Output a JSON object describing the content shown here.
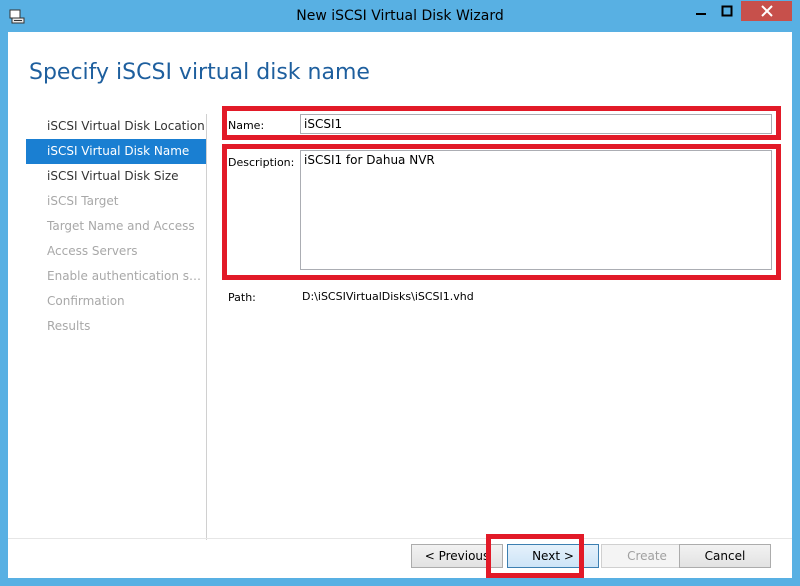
{
  "window": {
    "title": "New iSCSI Virtual Disk Wizard"
  },
  "page": {
    "heading": "Specify iSCSI virtual disk name"
  },
  "nav": {
    "items": [
      {
        "label": "iSCSI Virtual Disk Location",
        "state": "normal"
      },
      {
        "label": "iSCSI Virtual Disk Name",
        "state": "selected"
      },
      {
        "label": "iSCSI Virtual Disk Size",
        "state": "normal"
      },
      {
        "label": "iSCSI Target",
        "state": "disabled"
      },
      {
        "label": "Target Name and Access",
        "state": "disabled"
      },
      {
        "label": "Access Servers",
        "state": "disabled"
      },
      {
        "label": "Enable authentication ser...",
        "state": "disabled"
      },
      {
        "label": "Confirmation",
        "state": "disabled"
      },
      {
        "label": "Results",
        "state": "disabled"
      }
    ]
  },
  "form": {
    "name_label": "Name:",
    "name_value": "iSCSI1",
    "description_label": "Description:",
    "description_value": "iSCSI1 for Dahua NVR",
    "path_label": "Path:",
    "path_value": "D:\\iSCSIVirtualDisks\\iSCSI1.vhd"
  },
  "buttons": {
    "previous": "< Previous",
    "next": "Next >",
    "create": "Create",
    "cancel": "Cancel"
  },
  "colors": {
    "frame": "#58b0e3",
    "heading": "#1e5f9e",
    "nav_selected": "#1a7fd2",
    "highlight": "#e21a28",
    "close": "#c7504b"
  }
}
